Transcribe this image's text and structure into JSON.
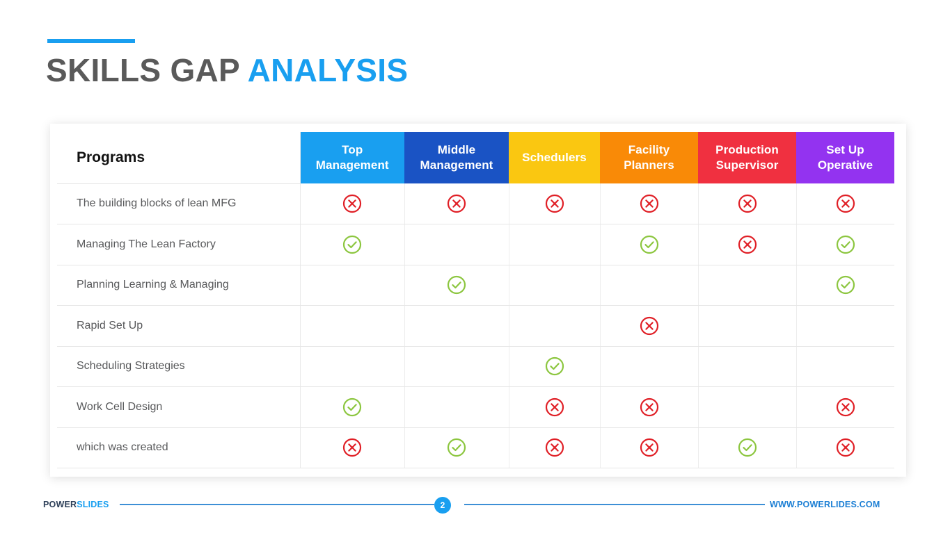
{
  "title": {
    "part1": "SKILLS GAP ",
    "part2": "ANALYSIS"
  },
  "table": {
    "corner_label": "Programs",
    "columns": [
      {
        "label_line1": "Top",
        "label_line2": "Management",
        "color": "#199FF0"
      },
      {
        "label_line1": "Middle",
        "label_line2": "Management",
        "color": "#1A53C4"
      },
      {
        "label_line1": "Schedulers",
        "label_line2": "",
        "color": "#FAC711"
      },
      {
        "label_line1": "Facility",
        "label_line2": "Planners",
        "color": "#F98A07"
      },
      {
        "label_line1": "Production",
        "label_line2": "Supervisor",
        "color": "#F03040"
      },
      {
        "label_line1": "Set Up",
        "label_line2": "Operative",
        "color": "#9333F0"
      }
    ],
    "rows": [
      {
        "label": "The building blocks of lean MFG",
        "marks": [
          "cross",
          "cross",
          "cross",
          "cross",
          "cross",
          "cross"
        ]
      },
      {
        "label": "Managing The Lean Factory",
        "marks": [
          "check",
          "",
          "",
          "check",
          "cross",
          "check"
        ]
      },
      {
        "label": "Planning Learning & Managing",
        "marks": [
          "",
          "check",
          "",
          "",
          "",
          "check"
        ]
      },
      {
        "label": "Rapid Set Up",
        "marks": [
          "",
          "",
          "",
          "cross",
          "",
          ""
        ]
      },
      {
        "label": "Scheduling Strategies",
        "marks": [
          "",
          "",
          "check",
          "",
          "",
          ""
        ]
      },
      {
        "label": "Work Cell Design",
        "marks": [
          "check",
          "",
          "cross",
          "cross",
          "",
          "cross"
        ]
      },
      {
        "label": "which was created",
        "marks": [
          "cross",
          "check",
          "cross",
          "cross",
          "check",
          "cross"
        ]
      }
    ],
    "mark_colors": {
      "check": "#8CC63F",
      "cross": "#E01F26"
    }
  },
  "footer": {
    "brand_part1": "POWER",
    "brand_part2": "SLIDES",
    "page_number": "2",
    "website": "WWW.POWERLIDES.COM"
  },
  "theme": {
    "accent": "#199FF0",
    "title_dark": "#5A5A5A"
  }
}
